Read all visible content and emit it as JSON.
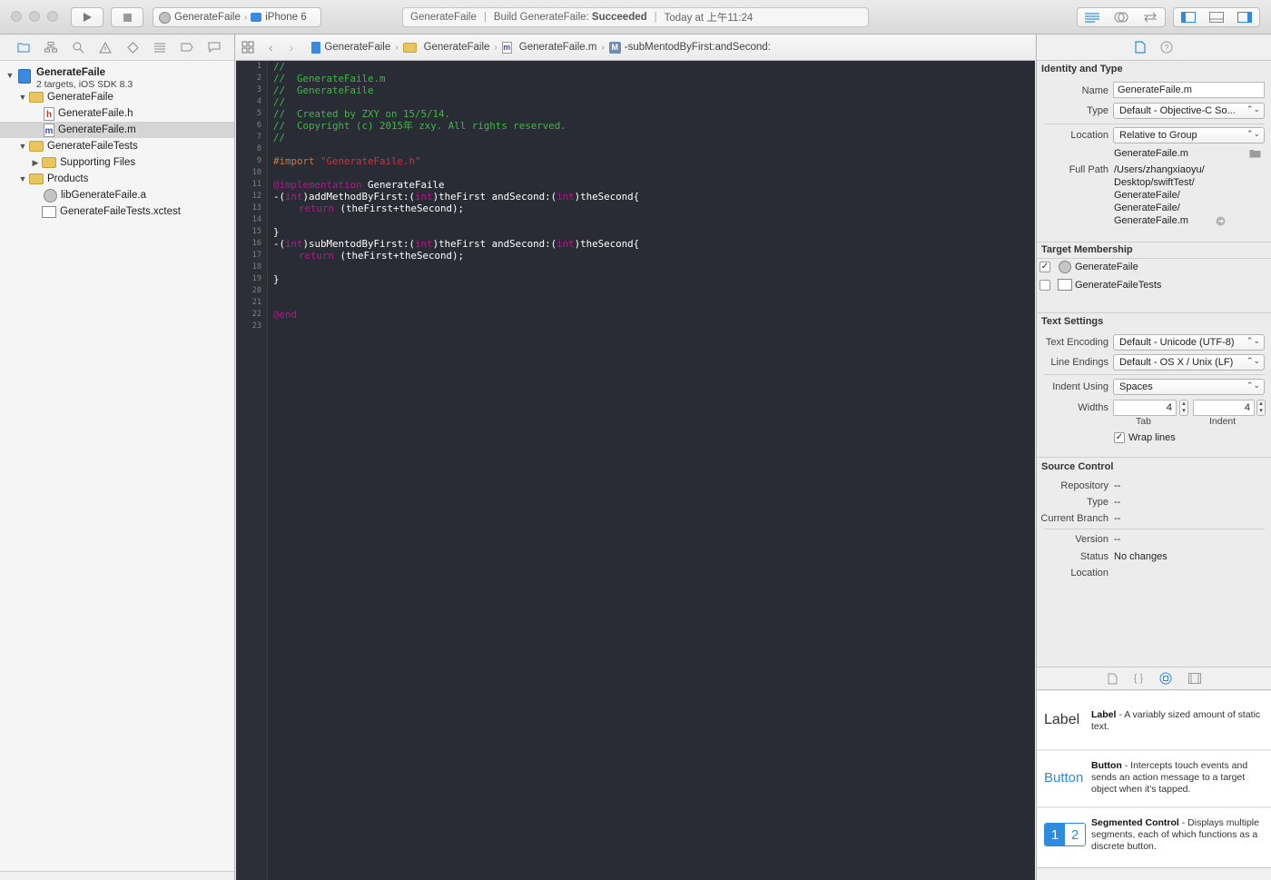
{
  "toolbar": {
    "scheme_target": "GenerateFaile",
    "scheme_device": "iPhone 6",
    "status_project": "GenerateFaile",
    "status_build_prefix": "Build GenerateFaile:",
    "status_build_result": "Succeeded",
    "status_time": "Today at 上午11:24"
  },
  "navigator": {
    "project_name": "GenerateFaile",
    "project_subtitle": "2 targets, iOS SDK 8.3",
    "items": [
      {
        "label": "GenerateFaile"
      },
      {
        "label": "GenerateFaile.h"
      },
      {
        "label": "GenerateFaile.m"
      },
      {
        "label": "GenerateFaileTests"
      },
      {
        "label": "Supporting Files"
      },
      {
        "label": "Products"
      },
      {
        "label": "libGenerateFaile.a"
      },
      {
        "label": "GenerateFaileTests.xctest"
      }
    ]
  },
  "jumpbar": {
    "crumbs": [
      "GenerateFaile",
      "GenerateFaile",
      "GenerateFaile.m",
      "-subMentodByFirst:andSecond:"
    ]
  },
  "editor": {
    "line_numbers": [
      "1",
      "2",
      "3",
      "4",
      "5",
      "6",
      "7",
      "8",
      "9",
      "10",
      "11",
      "12",
      "13",
      "14",
      "15",
      "16",
      "17",
      "18",
      "19",
      "20",
      "21",
      "22",
      "23"
    ],
    "lines": {
      "l1": "//",
      "l2": "//  GenerateFaile.m",
      "l3": "//  GenerateFaile",
      "l4": "//",
      "l5": "//  Created by ZXY on 15/5/14.",
      "l6": "//  Copyright (c) 2015年 zxy. All rights reserved.",
      "l7": "//",
      "l9_pre": "#import ",
      "l9_str": "\"GenerateFaile.h\"",
      "l11_kw": "@implementation",
      "l11_name": " GenerateFaile",
      "l12_a": "-(",
      "l12_b": "int",
      "l12_c": ")addMethodByFirst:(",
      "l12_d": "int",
      "l12_e": ")theFirst andSecond:(",
      "l12_f": "int",
      "l12_g": ")theSecond{",
      "l13_kw": "return",
      "l13_rest": " (theFirst+theSecond);",
      "l15": "}",
      "l16_a": "-(",
      "l16_b": "int",
      "l16_c": ")subMentodByFirst:(",
      "l16_d": "int",
      "l16_e": ")theFirst andSecond:(",
      "l16_f": "int",
      "l16_g": ")theSecond{",
      "l17_kw": "return",
      "l17_rest": " (theFirst+theSecond);",
      "l19": "}",
      "l22": "@end"
    }
  },
  "inspector": {
    "identity": {
      "title": "Identity and Type",
      "name_label": "Name",
      "name_value": "GenerateFaile.m",
      "type_label": "Type",
      "type_value": "Default - Objective-C So...",
      "location_label": "Location",
      "location_value": "Relative to Group",
      "location_file": "GenerateFaile.m",
      "fullpath_label": "Full Path",
      "fullpath_lines": [
        "/Users/zhangxiaoyu/",
        "Desktop/swiftTest/",
        "GenerateFaile/",
        "GenerateFaile/",
        "GenerateFaile.m"
      ]
    },
    "membership": {
      "title": "Target Membership",
      "targets": [
        {
          "label": "GenerateFaile",
          "checked": "✓"
        },
        {
          "label": "GenerateFaileTests",
          "checked": ""
        }
      ]
    },
    "text_settings": {
      "title": "Text Settings",
      "encoding_label": "Text Encoding",
      "encoding_value": "Default - Unicode (UTF-8)",
      "endings_label": "Line Endings",
      "endings_value": "Default - OS X / Unix (LF)",
      "indent_label": "Indent Using",
      "indent_value": "Spaces",
      "widths_label": "Widths",
      "tab_value": "4",
      "indent_width_value": "4",
      "tab_caption": "Tab",
      "indent_caption": "Indent",
      "wrap_label": "Wrap lines",
      "wrap_checked": "✓"
    },
    "source_control": {
      "title": "Source Control",
      "repository_label": "Repository",
      "repository_value": "--",
      "type_label": "Type",
      "type_value": "--",
      "branch_label": "Current Branch",
      "branch_value": "--",
      "version_label": "Version",
      "version_value": "--",
      "status_label": "Status",
      "status_value": "No changes",
      "location_label": "Location"
    },
    "library": {
      "items": [
        {
          "thumb": "Label",
          "name": "Label",
          "desc": " - A variably sized amount of static text."
        },
        {
          "thumb": "Button",
          "name": "Button",
          "desc": " - Intercepts touch events and sends an action message to a target object when it's tapped."
        },
        {
          "thumb1": "1",
          "thumb2": "2",
          "name": "Segmented Control",
          "desc": " - Displays multiple segments, each of which functions as a discrete button."
        }
      ]
    }
  },
  "colors": {
    "editor_bg": "#292c35",
    "comment": "#41b645",
    "keyword": "#b21889",
    "string": "#db2c38",
    "preprocessor": "#c57c4b",
    "accent": "#2f8bde"
  }
}
